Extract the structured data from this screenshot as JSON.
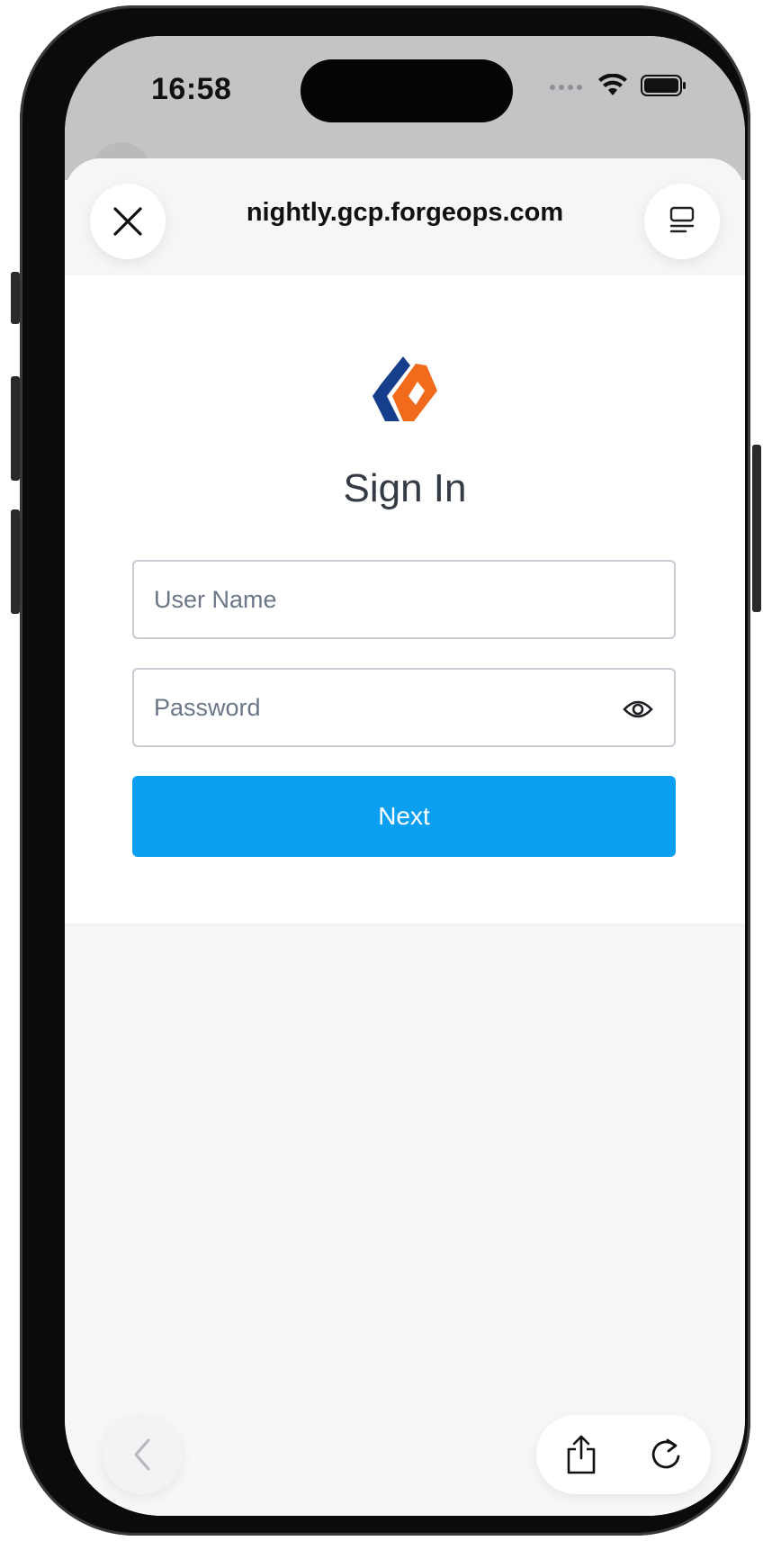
{
  "status_bar": {
    "time": "16:58"
  },
  "browser": {
    "url": "nightly.gcp.forgeops.com",
    "icons": {
      "close": "close-icon",
      "reader": "reader-mode-icon",
      "back": "chevron-left-icon",
      "share": "share-icon",
      "reload": "reload-icon"
    }
  },
  "login": {
    "title": "Sign In",
    "username_placeholder": "User Name",
    "password_placeholder": "Password",
    "submit_label": "Next"
  },
  "colors": {
    "primary_button": "#0b9ff2",
    "logo_blue": "#173e8c",
    "logo_orange": "#f26b1d"
  }
}
